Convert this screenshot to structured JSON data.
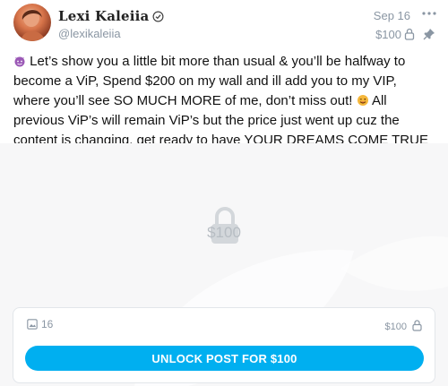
{
  "author": {
    "name": "Lexi Kaleiia",
    "handle": "@lexikaleiia",
    "verified": true
  },
  "post": {
    "date": "Sep 16",
    "price": "$100",
    "text_1": "Let’s show you a little bit more than usual & you’ll be halfway to become a ViP, Spend $200 on my wall and ill add you to my VIP, where you’ll see SO MUCH MORE of me, don’t miss out!",
    "text_2": "All previous ViP’s will remain ViP’s but the price just went up cuz the content is changing, get ready to have YOUR DREAMS COME TRUE"
  },
  "media": {
    "locked_price": "$100",
    "image_count": "16"
  },
  "locked_card": {
    "price": "$100",
    "unlock_label": "UNLOCK POST FOR $100"
  },
  "colors": {
    "accent": "#00aff0",
    "muted": "#8a96a3"
  },
  "icons": [
    "verified-icon",
    "more-options-icon",
    "lock-icon",
    "pin-icon",
    "image-icon",
    "devil-emoji-icon",
    "wink-emoji-icon"
  ]
}
